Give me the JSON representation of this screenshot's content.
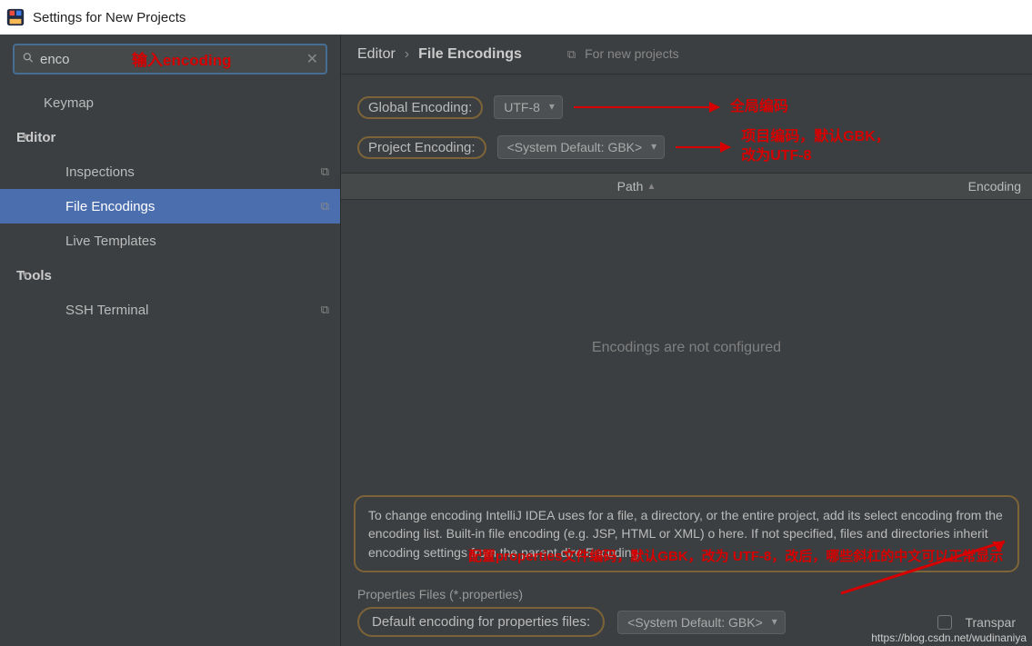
{
  "window": {
    "title": "Settings for New Projects"
  },
  "search": {
    "value": "enco",
    "placeholder": "",
    "annotation": "输入encoding"
  },
  "sidebar": {
    "items": [
      {
        "label": "Keymap",
        "level": 1,
        "chev": false,
        "copy": false,
        "selected": false
      },
      {
        "label": "Editor",
        "level": 0,
        "chev": true,
        "copy": false,
        "selected": false,
        "bold": true
      },
      {
        "label": "Inspections",
        "level": 2,
        "chev": false,
        "copy": true,
        "selected": false
      },
      {
        "label": "File Encodings",
        "level": 2,
        "chev": false,
        "copy": true,
        "selected": true
      },
      {
        "label": "Live Templates",
        "level": 2,
        "chev": false,
        "copy": false,
        "selected": false
      },
      {
        "label": "Tools",
        "level": 0,
        "chev": true,
        "copy": false,
        "selected": false,
        "bold": true
      },
      {
        "label": "SSH Terminal",
        "level": 2,
        "chev": false,
        "copy": true,
        "selected": false
      }
    ]
  },
  "breadcrumb": {
    "crumb1": "Editor",
    "crumb2": "File Encodings",
    "newproj": "For new projects"
  },
  "form": {
    "global_label": "Global Encoding:",
    "global_value": "UTF-8",
    "global_annot": "全局编码",
    "project_label": "Project Encoding:",
    "project_value": "<System Default: GBK>",
    "project_annot": "项目编码，默认GBK，\n改为UTF-8"
  },
  "table": {
    "col_path": "Path",
    "col_enc": "Encoding",
    "empty": "Encodings are not configured"
  },
  "help": {
    "text": "To change encoding IntelliJ IDEA uses for a file, a directory, or the entire project, add its select encoding from the encoding list. Built-in file encoding (e.g. JSP, HTML or XML) o here. If not specified, files and directories inherit encoding settings from the parent dire Encoding.",
    "annotation": "配置properties文件编码，默认GBK，改为\nUTF-8，改后，哪些斜杠的中文可以正常显示"
  },
  "props": {
    "section_title": "Properties Files (*.properties)",
    "default_label": "Default encoding for properties files:",
    "default_value": "<System Default: GBK>",
    "transparent_label": "Transpar"
  },
  "watermark": "https://blog.csdn.net/wudinaniya"
}
